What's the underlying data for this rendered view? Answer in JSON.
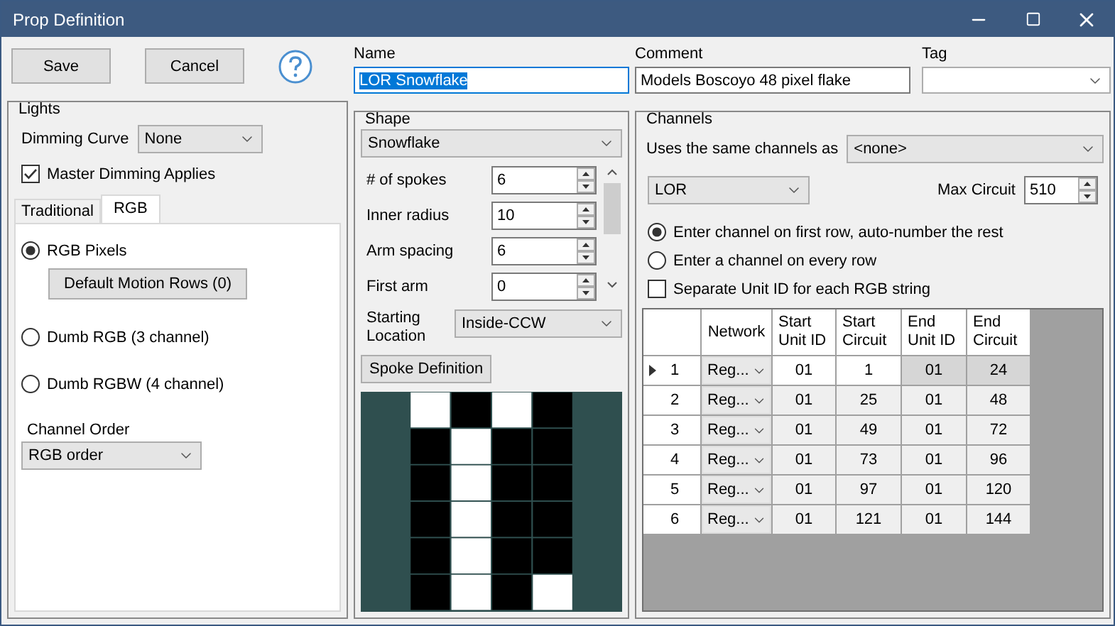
{
  "window": {
    "title": "Prop Definition"
  },
  "buttons": [
    {
      "label": "Save"
    },
    {
      "label": "Cancel"
    }
  ],
  "lights": {
    "title": "Lights",
    "dimming_curve": {
      "label": "Dimming Curve",
      "value": "None"
    },
    "master_dimming": {
      "label": "Master Dimming Applies",
      "checked": true
    },
    "tabs": [
      {
        "label": "Traditional",
        "selected": false
      },
      {
        "label": "RGB",
        "selected": true
      }
    ],
    "rgb_options": [
      {
        "label": "RGB Pixels",
        "selected": true
      },
      {
        "label": "Dumb RGB (3 channel)",
        "selected": false
      },
      {
        "label": "Dumb RGBW (4 channel)",
        "selected": false
      }
    ],
    "motion_button": "Default Motion Rows (0)",
    "channel_order": {
      "label": "Channel Order",
      "value": "RGB order"
    }
  },
  "name": {
    "label": "Name",
    "value": "LOR Snowflake",
    "text_selected": true
  },
  "shape": {
    "title": "Shape",
    "type": "Snowflake",
    "params": [
      {
        "label": "# of spokes",
        "value": "6"
      },
      {
        "label": "Inner radius",
        "value": "10"
      },
      {
        "label": "Arm spacing",
        "value": "6"
      },
      {
        "label": "First arm",
        "value": "0"
      }
    ],
    "starting_location": {
      "label": "Starting Location",
      "value": "Inside-CCW"
    },
    "spoke_button": "Spoke Definition",
    "pixel_grid": [
      [
        true,
        false,
        true,
        false
      ],
      [
        false,
        true,
        false,
        false
      ],
      [
        false,
        true,
        false,
        false
      ],
      [
        false,
        true,
        false,
        false
      ],
      [
        false,
        true,
        false,
        false
      ],
      [
        false,
        true,
        false,
        true
      ]
    ]
  },
  "comment": {
    "label": "Comment",
    "value": "Models Boscoyo 48 pixel flake"
  },
  "tag": {
    "label": "Tag"
  },
  "channels": {
    "title": "Channels",
    "same_as": {
      "label": "Uses the same channels as",
      "value": "<none>"
    },
    "network_type": "LOR",
    "max_circuit": {
      "label": "Max Circuit",
      "value": "510"
    },
    "numbering": [
      {
        "label": "Enter channel on first row, auto-number the rest",
        "selected": true
      },
      {
        "label": "Enter a channel on every row",
        "selected": false
      }
    ],
    "separate_unit_id": {
      "label": "Separate Unit ID for each RGB string",
      "checked": false
    },
    "table": {
      "columns": [
        "Network",
        "Start Unit ID",
        "Start Circuit",
        "End Unit ID",
        "End Circuit"
      ],
      "rows": [
        {
          "number": "1",
          "selected": true,
          "network": "Reg...",
          "start_unit": "01",
          "start_circuit": "1",
          "end_unit": "01",
          "end_circuit": "24"
        },
        {
          "number": "2",
          "selected": false,
          "network": "Reg...",
          "start_unit": "01",
          "start_circuit": "25",
          "end_unit": "01",
          "end_circuit": "48"
        },
        {
          "number": "3",
          "selected": false,
          "network": "Reg...",
          "start_unit": "01",
          "start_circuit": "49",
          "end_unit": "01",
          "end_circuit": "72"
        },
        {
          "number": "4",
          "selected": false,
          "network": "Reg...",
          "start_unit": "01",
          "start_circuit": "73",
          "end_unit": "01",
          "end_circuit": "96"
        },
        {
          "number": "5",
          "selected": false,
          "network": "Reg...",
          "start_unit": "01",
          "start_circuit": "97",
          "end_unit": "01",
          "end_circuit": "120"
        },
        {
          "number": "6",
          "selected": false,
          "network": "Reg...",
          "start_unit": "01",
          "start_circuit": "121",
          "end_unit": "01",
          "end_circuit": "144"
        }
      ]
    }
  }
}
